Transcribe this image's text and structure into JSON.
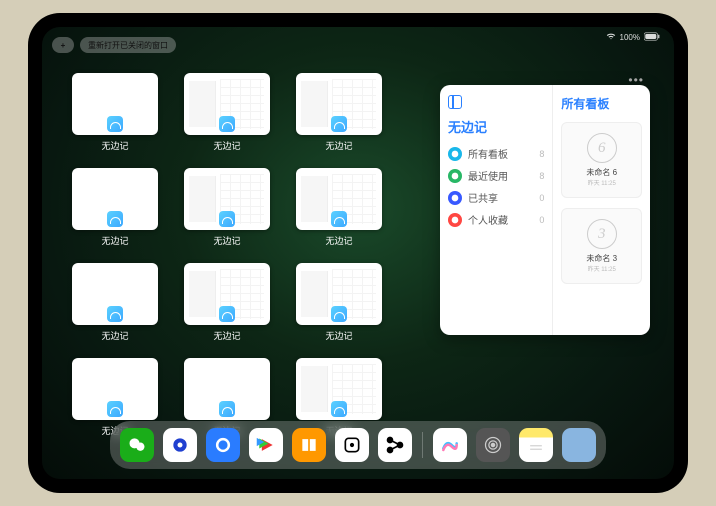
{
  "status": {
    "battery": "100%"
  },
  "topbar": {
    "plus": "+",
    "reopen_label": "重新打开已关闭的窗口"
  },
  "app_label": "无边记",
  "windows": [
    {
      "type": "blank"
    },
    {
      "type": "calendar"
    },
    {
      "type": "calendar"
    },
    {
      "type": "blank"
    },
    {
      "type": "calendar"
    },
    {
      "type": "calendar"
    },
    {
      "type": "blank"
    },
    {
      "type": "calendar"
    },
    {
      "type": "calendar"
    },
    {
      "type": "blank"
    },
    {
      "type": "blank"
    },
    {
      "type": "calendar"
    }
  ],
  "popover": {
    "title": "无边记",
    "right_title": "所有看板",
    "items": [
      {
        "label": "所有看板",
        "count": "8",
        "color": "c-blue"
      },
      {
        "label": "最近使用",
        "count": "8",
        "color": "c-green"
      },
      {
        "label": "已共享",
        "count": "0",
        "color": "c-indigo"
      },
      {
        "label": "个人收藏",
        "count": "0",
        "color": "c-red"
      }
    ],
    "boards": [
      {
        "digit": "6",
        "name": "未命名 6",
        "sub": "昨天 11:25"
      },
      {
        "digit": "3",
        "name": "未命名 3",
        "sub": "昨天 11:25"
      }
    ]
  },
  "dock": {
    "apps": [
      {
        "name": "wechat"
      },
      {
        "name": "browser-hd"
      },
      {
        "name": "quark"
      },
      {
        "name": "play-video"
      },
      {
        "name": "books"
      },
      {
        "name": "dice"
      },
      {
        "name": "graph"
      },
      {
        "name": "freeform"
      },
      {
        "name": "settings"
      },
      {
        "name": "notes"
      },
      {
        "name": "app-library"
      }
    ]
  }
}
